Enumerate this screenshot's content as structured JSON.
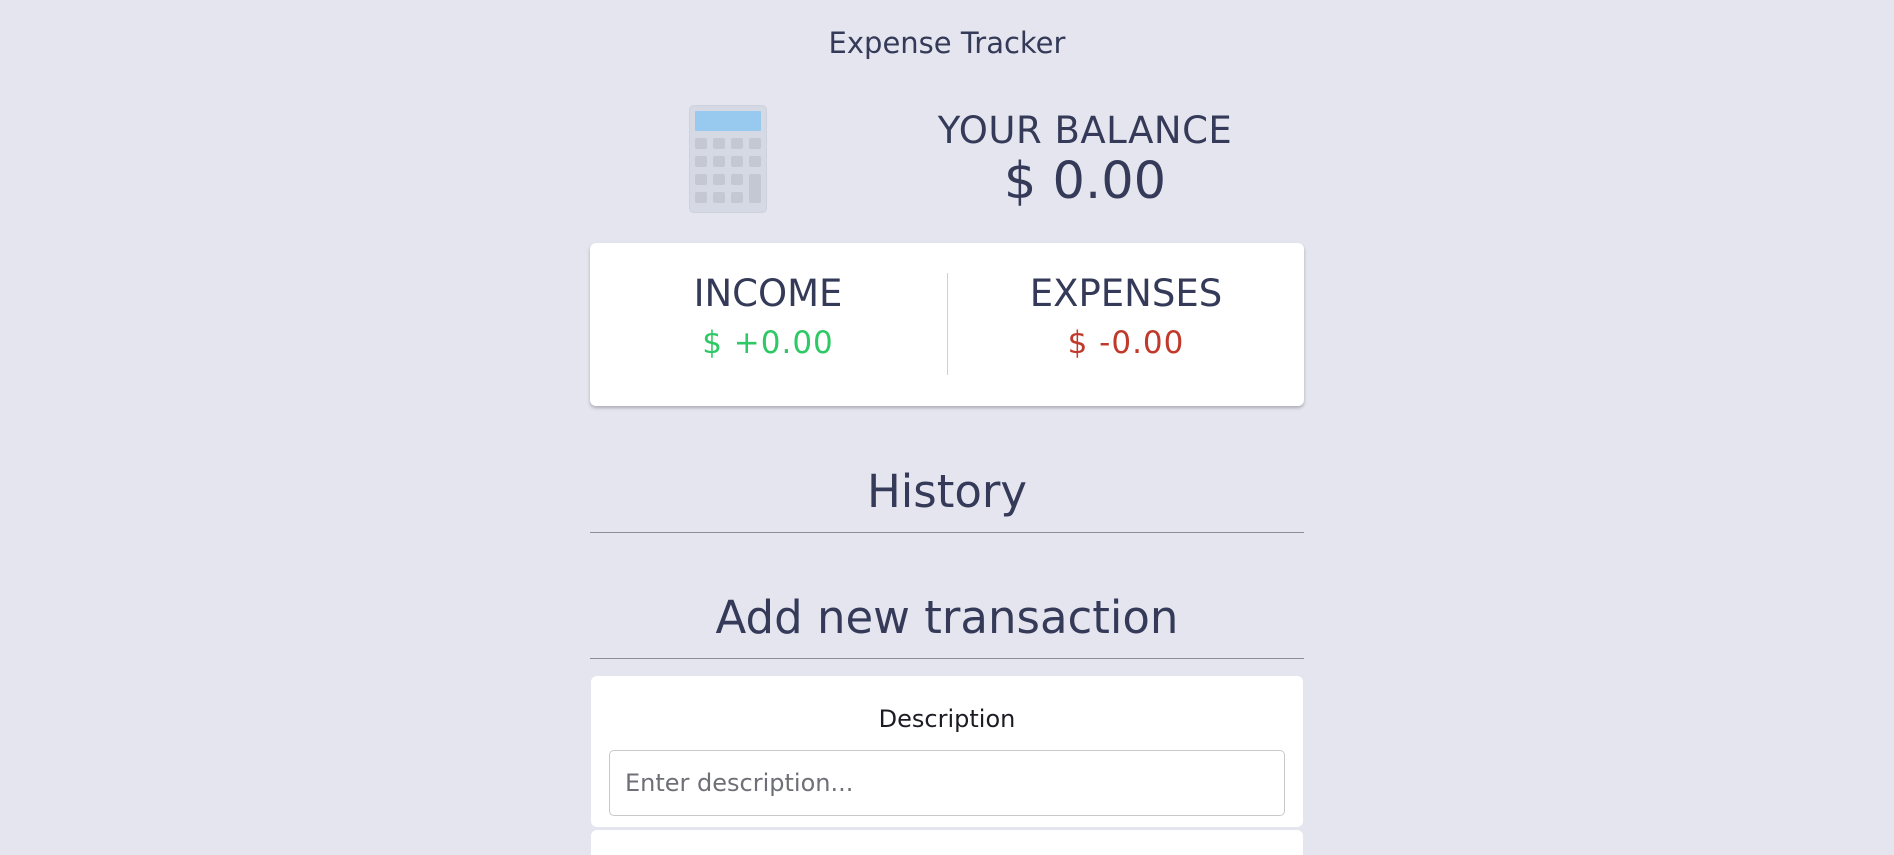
{
  "app": {
    "title": "Expense Tracker"
  },
  "balance": {
    "label": "YOUR BALANCE",
    "value": "$ 0.00"
  },
  "summary": {
    "income_label": "INCOME",
    "income_value": "$ +0.00",
    "expenses_label": "EXPENSES",
    "expenses_value": "$ -0.00"
  },
  "history": {
    "heading": "History"
  },
  "add_transaction": {
    "heading": "Add new transaction",
    "description_label": "Description",
    "description_value": "",
    "description_placeholder": "Enter description..."
  },
  "icons": {
    "balance_icon": "calculator-icon"
  },
  "colors": {
    "background": "#e4e5ef",
    "text": "#343a57",
    "income": "#2ec866",
    "expenses": "#c0392b",
    "card": "#ffffff"
  }
}
